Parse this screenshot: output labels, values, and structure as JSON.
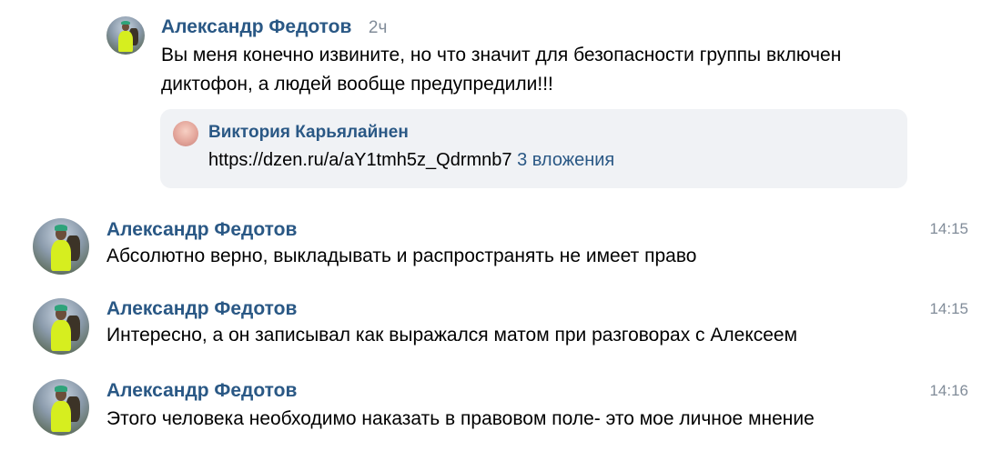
{
  "thread_reply": {
    "author": "Александр Федотов",
    "time": "2ч",
    "text_line1": "Вы меня конечно извините, но что значит для безопасности группы включен",
    "text_line2": "диктофон, а людей вообще предупредили!!!",
    "quoted": {
      "author": "Виктория Карьялайнен",
      "link": "https://dzen.ru/a/aY1tmh5z_Qdrmnb7",
      "attachments": "3 вложения"
    }
  },
  "messages": [
    {
      "author": "Александр Федотов",
      "time": "14:15",
      "text": "Абсолютно верно, выкладывать и распространять не имеет право"
    },
    {
      "author": "Александр Федотов",
      "time": "14:15",
      "text": "Интересно, а он записывал как выражался матом при разговорах с Алексеем"
    },
    {
      "author": "Александр Федотов",
      "time": "14:16",
      "text": "Этого человека необходимо наказать в правовом поле- это мое личное мнение"
    }
  ]
}
